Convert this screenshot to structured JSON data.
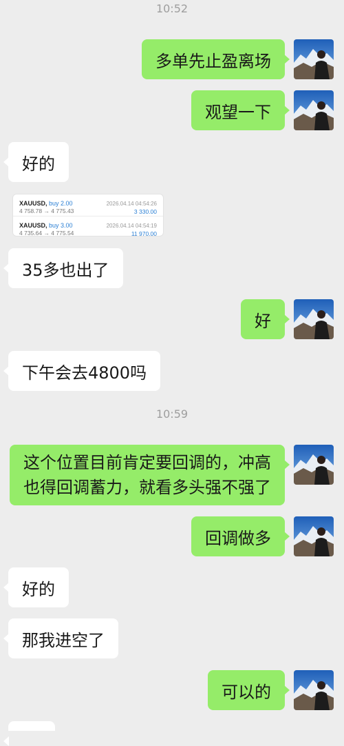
{
  "timestamps": [
    "10:52",
    "10:59"
  ],
  "messages": [
    {
      "side": "right",
      "text": "多单先止盈离场"
    },
    {
      "side": "right",
      "text": "观望一下"
    },
    {
      "side": "left",
      "text": "好的"
    },
    {
      "side": "left",
      "type": "trade-card"
    },
    {
      "side": "left",
      "text": "35多也出了"
    },
    {
      "side": "right",
      "text": "好"
    },
    {
      "side": "left",
      "text": "下午会去4800吗"
    },
    {
      "side": "right",
      "text": "这个位置目前肯定要回调的，冲高也得回调蓄力，就看多头强不强了"
    },
    {
      "side": "right",
      "text": "回调做多"
    },
    {
      "side": "left",
      "text": "好的"
    },
    {
      "side": "left",
      "text": "那我进空了"
    },
    {
      "side": "right",
      "text": "可以的"
    }
  ],
  "trade_card": {
    "trades": [
      {
        "symbol": "XAUUSD,",
        "direction": "buy 2.00",
        "prices": "4 758.78 → 4 775.43",
        "datetime": "2026.04.14 04:54:26",
        "profit": "3 330.00"
      },
      {
        "symbol": "XAUUSD,",
        "direction": "buy 3.00",
        "prices": "4 735.64 → 4 775.54",
        "datetime": "2026.04.14 04:54:19",
        "profit": "11 970.00"
      }
    ]
  },
  "colors": {
    "background": "#ededed",
    "sent_bubble": "#95ec69",
    "received_bubble": "#ffffff",
    "profit": "#2a7fd4"
  },
  "avatar_icon": "mountain-portrait-avatar"
}
